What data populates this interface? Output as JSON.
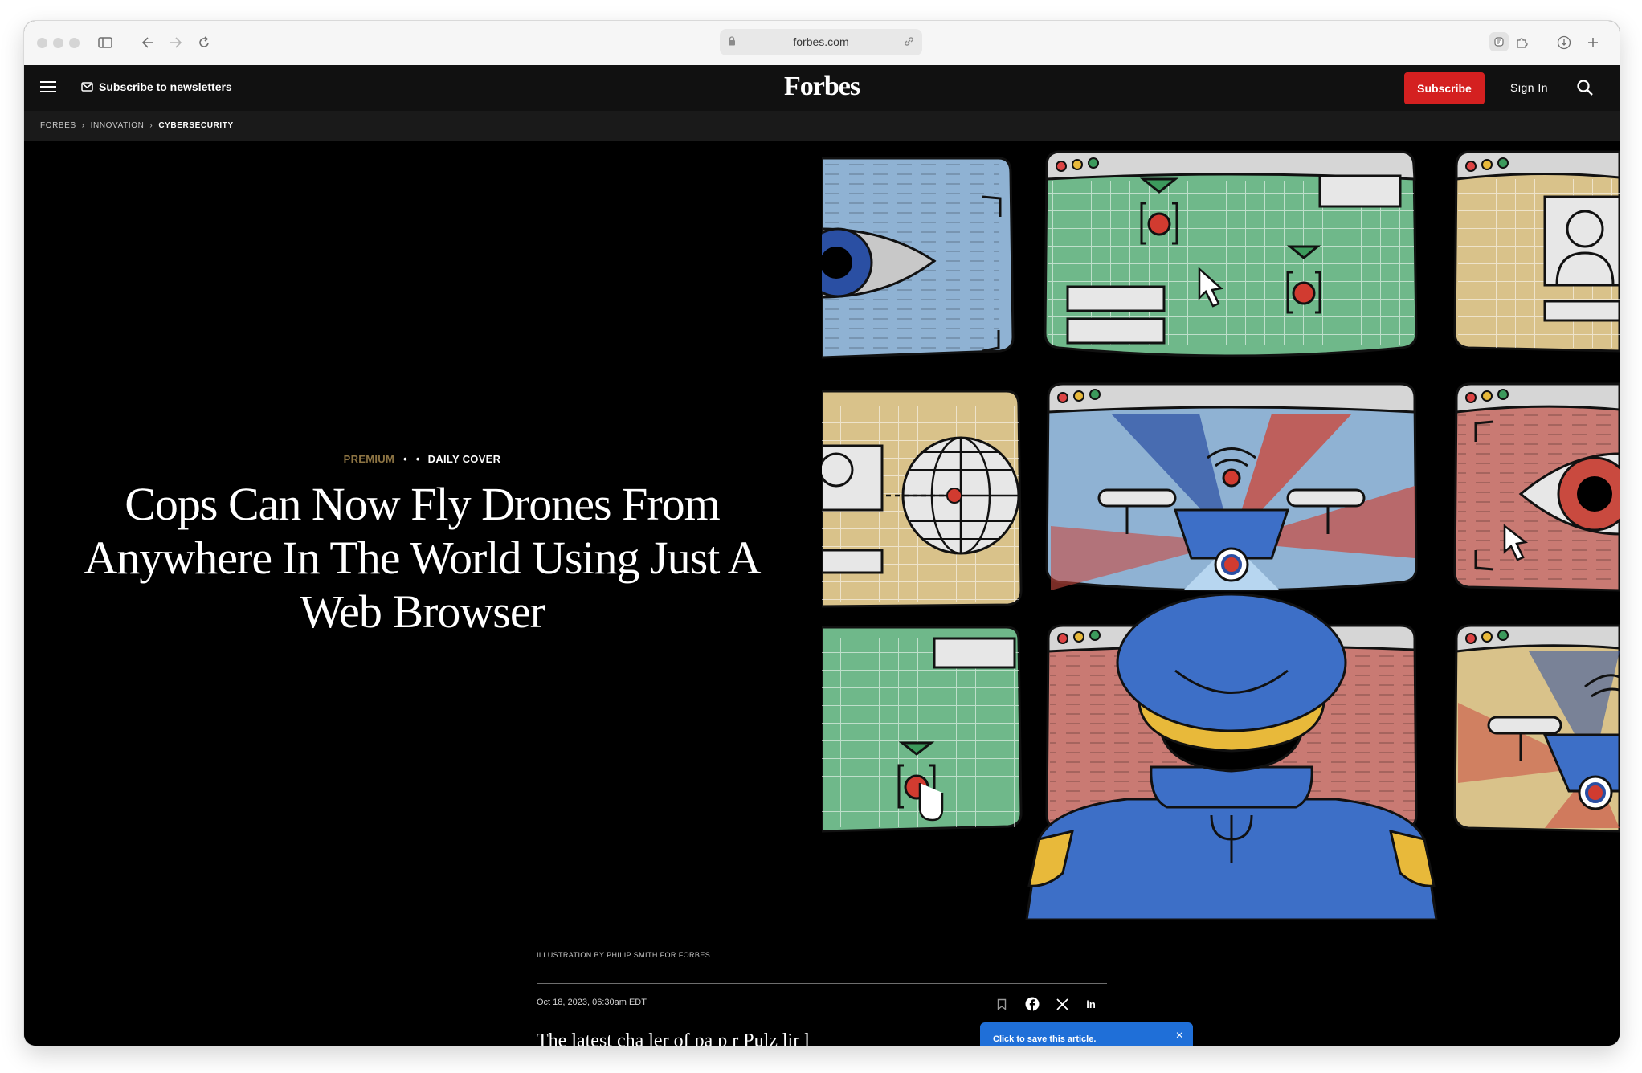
{
  "browser": {
    "url": "forbes.com"
  },
  "header": {
    "newsletter_label": "Subscribe to newsletters",
    "logo": "Forbes",
    "subscribe_label": "Subscribe",
    "signin_label": "Sign In",
    "accent_color": "#d42020"
  },
  "breadcrumb": {
    "items": [
      "FORBES",
      "INNOVATION",
      "CYBERSECURITY"
    ]
  },
  "article": {
    "tag_premium": "PREMIUM",
    "tag_daily": "DAILY COVER",
    "headline": "Cops Can Now Fly Drones From Anywhere In The World Using Just A Web Browser",
    "illustration_credit": "ILLUSTRATION BY PHILIP SMITH FOR FORBES",
    "date": "Oct 18, 2023, 06:30am EDT",
    "body_start": "The latest cha ler of  pa  p r  Pulz lir  l"
  },
  "toast": {
    "text": "Click to save this article.",
    "close": "×"
  },
  "icons": [
    "hamburger-icon",
    "mail-icon",
    "search-icon",
    "bookmark-icon",
    "facebook-icon",
    "x-icon",
    "linkedin-icon",
    "lock-icon",
    "link-icon",
    "sidebar-icon",
    "back-icon",
    "forward-icon",
    "reload-icon",
    "download-icon",
    "new-tab-icon"
  ]
}
